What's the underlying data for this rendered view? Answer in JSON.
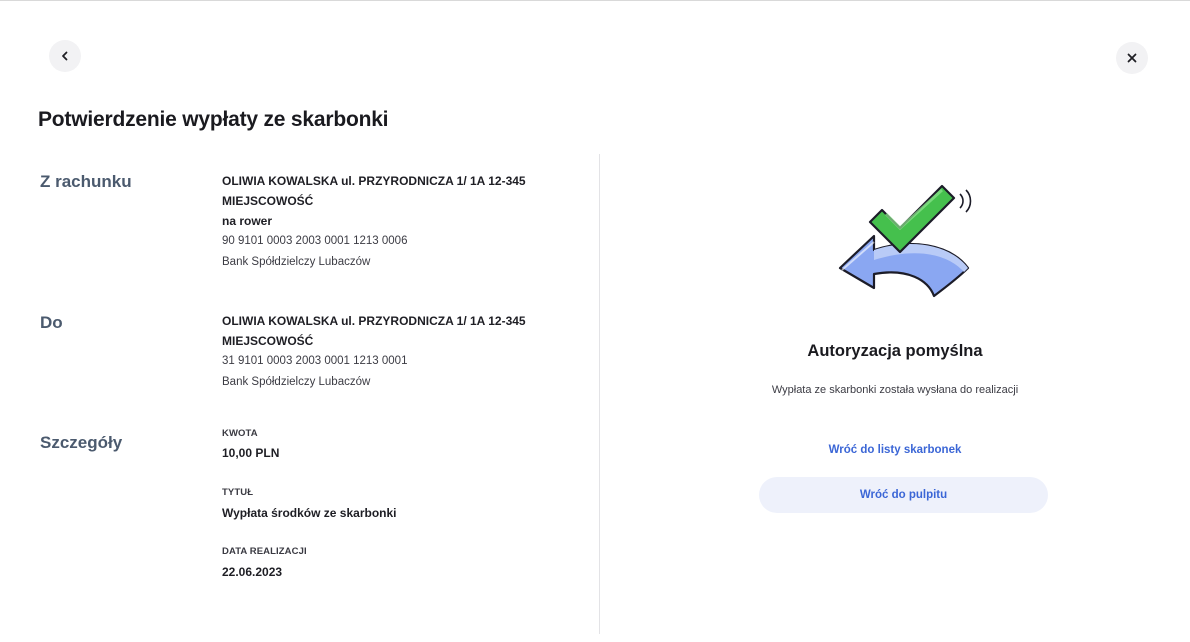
{
  "header": {
    "back_icon": "chevron-left-icon",
    "close_icon": "close-icon",
    "title": "Potwierdzenie wypłaty ze skarbonki"
  },
  "from": {
    "label": "Z rachunku",
    "name_line1": "OLIWIA KOWALSKA ul. PRZYRODNICZA 1/ 1A 12-345",
    "name_line2": "MIEJSCOWOŚĆ",
    "account_name": "na rower",
    "account_number": "90 9101 0003 2003 0001 1213 0006",
    "bank": "Bank Spółdzielczy Lubaczów"
  },
  "to": {
    "label": "Do",
    "name_line1": "OLIWIA KOWALSKA ul. PRZYRODNICZA 1/ 1A 12-345",
    "name_line2": "MIEJSCOWOŚĆ",
    "account_number": "31 9101 0003 2003 0001 1213 0001",
    "bank": "Bank Spółdzielczy Lubaczów"
  },
  "details": {
    "label": "Szczegóły",
    "amount_label": "KWOTA",
    "amount_value": "10,00 PLN",
    "title_label": "TYTUŁ",
    "title_value": "Wypłata środków ze skarbonki",
    "date_label": "DATA REALIZACJI",
    "date_value": "22.06.2023"
  },
  "result": {
    "icon": "success-check-return-icon",
    "title": "Autoryzacja pomyślna",
    "description": "Wypłata ze skarbonki została wysłana do realizacji",
    "link_back_list": "Wróć do listy skarbonek",
    "button_dashboard": "Wróć do pulpitu"
  },
  "colors": {
    "accent": "#3b66d6",
    "button_bg": "#eef1fb",
    "check_green": "#3fb94a",
    "arrow_blue": "#7f9ef0"
  }
}
